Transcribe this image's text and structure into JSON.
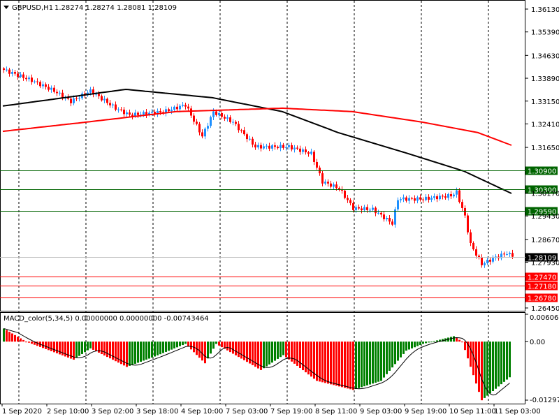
{
  "header": {
    "symbol": "GBPUSD,H1",
    "ohlc": "1.28274 1.28274 1.28081 1.28109"
  },
  "macd": {
    "label": "MACD_color(5,34,5) 0.00000000 0.00000000 -0.00743464",
    "ticks": [
      "0.0060671",
      "0.00",
      "-0.012973"
    ],
    "max": 0.0060671,
    "min": -0.012973
  },
  "price_axis": {
    "ticks": [
      "1.36130",
      "1.35390",
      "1.34630",
      "1.33890",
      "1.33150",
      "1.32410",
      "1.31650",
      "1.30170",
      "1.29430",
      "1.28670",
      "1.27930",
      "1.26450"
    ],
    "max": 1.3613,
    "min": 1.2645
  },
  "levels": [
    {
      "value": "1.30900",
      "color": "#006400"
    },
    {
      "value": "1.30300",
      "color": "#006400"
    },
    {
      "value": "1.29590",
      "color": "#006400"
    },
    {
      "value": "1.27470",
      "color": "#ff0000"
    },
    {
      "value": "1.27180",
      "color": "#ff0000"
    },
    {
      "value": "1.26780",
      "color": "#ff0000"
    }
  ],
  "current_price": "1.28109",
  "time_axis": [
    "1 Sep 2020",
    "2 Sep 10:00",
    "3 Sep 02:00",
    "3 Sep 18:00",
    "4 Sep 10:00",
    "7 Sep 03:00",
    "7 Sep 19:00",
    "8 Sep 11:00",
    "9 Sep 03:00",
    "9 Sep 19:00",
    "10 Sep 11:00",
    "11 Sep 03:00"
  ],
  "colors": {
    "bull": "#1e90ff",
    "bear": "#ff0000",
    "ma_fast": "#000000",
    "ma_slow": "#ff0000",
    "hist_up": "#008000",
    "hist_down": "#ff0000"
  },
  "chart_data": {
    "type": "candlestick",
    "bars": 182,
    "close_anchors": [
      [
        0,
        1.3416
      ],
      [
        10,
        1.3382
      ],
      [
        18,
        1.3348
      ],
      [
        24,
        1.3314
      ],
      [
        31,
        1.3348
      ],
      [
        40,
        1.3292
      ],
      [
        45,
        1.327
      ],
      [
        57,
        1.328
      ],
      [
        65,
        1.3303
      ],
      [
        71,
        1.3201
      ],
      [
        75,
        1.328
      ],
      [
        82,
        1.3247
      ],
      [
        90,
        1.3167
      ],
      [
        102,
        1.3167
      ],
      [
        110,
        1.3145
      ],
      [
        114,
        1.3054
      ],
      [
        120,
        1.3032
      ],
      [
        125,
        1.2968
      ],
      [
        132,
        1.2964
      ],
      [
        139,
        1.2919
      ],
      [
        141,
        1.2998
      ],
      [
        150,
        1.2998
      ],
      [
        160,
        1.3009
      ],
      [
        162,
        1.302
      ],
      [
        165,
        1.2941
      ],
      [
        167,
        1.2851
      ],
      [
        171,
        1.2787
      ],
      [
        175,
        1.2805
      ],
      [
        180,
        1.2823
      ],
      [
        182,
        1.28109
      ]
    ],
    "ma_fast": [
      [
        0,
        1.3299
      ],
      [
        44,
        1.3353
      ],
      [
        75,
        1.3326
      ],
      [
        100,
        1.3281
      ],
      [
        120,
        1.3213
      ],
      [
        145,
        1.3145
      ],
      [
        165,
        1.3088
      ],
      [
        182,
        1.3016
      ]
    ],
    "ma_slow": [
      [
        0,
        1.3217
      ],
      [
        30,
        1.3247
      ],
      [
        62,
        1.3281
      ],
      [
        100,
        1.3292
      ],
      [
        125,
        1.3281
      ],
      [
        150,
        1.3247
      ],
      [
        170,
        1.3213
      ],
      [
        182,
        1.3172
      ]
    ],
    "macd_hist": [
      [
        0,
        0.0029
      ],
      [
        8,
        0
      ],
      [
        25,
        -0.004
      ],
      [
        31,
        -0.0015
      ],
      [
        44,
        -0.0056
      ],
      [
        54,
        -0.0033
      ],
      [
        65,
        -0.0005
      ],
      [
        72,
        -0.0048
      ],
      [
        76,
        -0.0005
      ],
      [
        92,
        -0.0063
      ],
      [
        100,
        -0.003
      ],
      [
        112,
        -0.0087
      ],
      [
        125,
        -0.0107
      ],
      [
        135,
        -0.0087
      ],
      [
        144,
        -0.002
      ],
      [
        150,
        -0.0005
      ],
      [
        161,
        0.0012
      ],
      [
        164,
        0
      ],
      [
        171,
        -0.013
      ],
      [
        181,
        -0.0079
      ]
    ]
  }
}
